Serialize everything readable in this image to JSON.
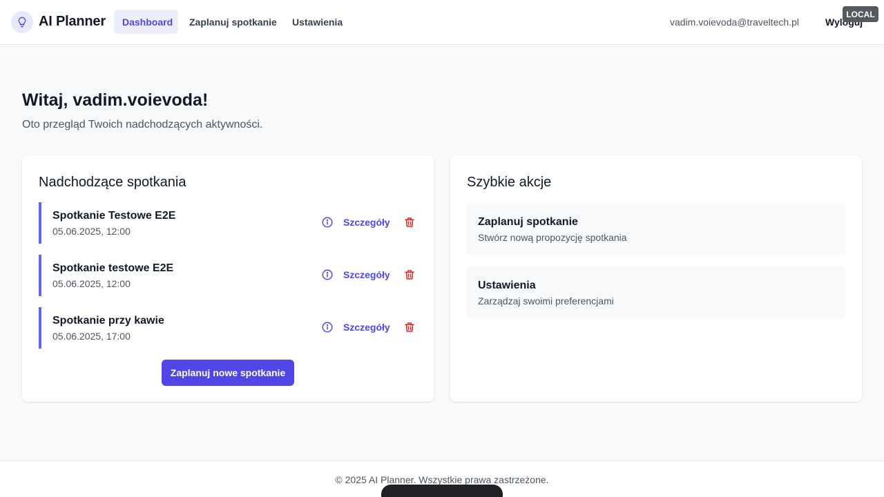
{
  "header": {
    "app_title": "AI Planner",
    "nav": [
      {
        "label": "Dashboard",
        "active": true
      },
      {
        "label": "Zaplanuj spotkanie",
        "active": false
      },
      {
        "label": "Ustawienia",
        "active": false
      }
    ],
    "user_email": "vadim.voievoda@traveltech.pl",
    "logout_label": "Wyloguj",
    "env_badge": "LOCAL"
  },
  "welcome": {
    "title": "Witaj, vadim.voievoda!",
    "subtitle": "Oto przegląd Twoich nadchodzących aktywności."
  },
  "meetings_card": {
    "title": "Nadchodzące spotkania",
    "details_label": "Szczegóły",
    "items": [
      {
        "title": "Spotkanie Testowe E2E",
        "date": "05.06.2025, 12:00"
      },
      {
        "title": "Spotkanie testowe E2E",
        "date": "05.06.2025, 12:00"
      },
      {
        "title": "Spotkanie przy kawie",
        "date": "05.06.2025, 17:00"
      }
    ],
    "new_meeting_button": "Zaplanuj nowe spotkanie"
  },
  "quick_actions": {
    "title": "Szybkie akcje",
    "items": [
      {
        "title": "Zaplanuj spotkanie",
        "description": "Stwórz nową propozycję spotkania"
      },
      {
        "title": "Ustawienia",
        "description": "Zarządzaj swoimi preferencjami"
      }
    ]
  },
  "footer": {
    "text": "© 2025 AI Planner. Wszystkie prawa zastrzeżone."
  },
  "colors": {
    "accent": "#4f46e5",
    "meeting_border": "#6366f1",
    "danger": "#dc2626"
  },
  "icons": {
    "logo": "lightbulb-icon",
    "info": "info-icon",
    "delete": "trash-icon"
  }
}
